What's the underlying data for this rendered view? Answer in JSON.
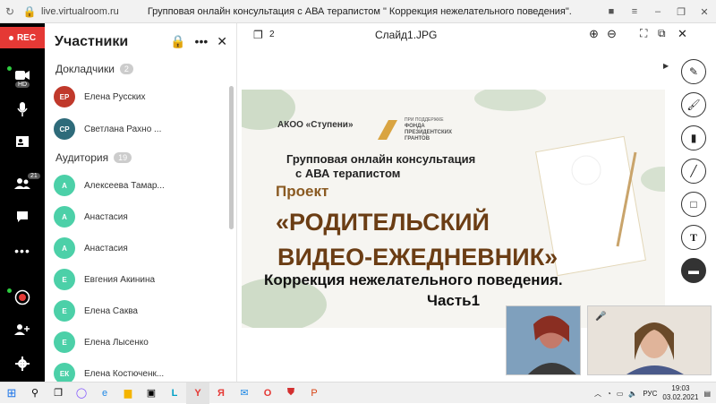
{
  "browser": {
    "url": "live.virtualroom.ru",
    "title": "Групповая онлайн консультация с АВА терапистом \" Коррекция нежелательного поведения\"."
  },
  "rail": {
    "rec_label": "REC",
    "hd_badge": "HD",
    "participants_count": "21"
  },
  "participants": {
    "title": "Участники",
    "speakers_label": "Докладчики",
    "speakers_count": "2",
    "audience_label": "Аудитория",
    "audience_count": "19",
    "speakers": [
      {
        "initials": "ЕР",
        "name": "Елена Русских",
        "color": "#c0392b"
      },
      {
        "initials": "СР",
        "name": "Светлана Рахно ...",
        "color": "#2e6b7a"
      }
    ],
    "audience": [
      {
        "initials": "А",
        "name": "Алексеева Тамар..."
      },
      {
        "initials": "А",
        "name": "Анастасия"
      },
      {
        "initials": "А",
        "name": "Анастасия"
      },
      {
        "initials": "Е",
        "name": "Евгения Акинина"
      },
      {
        "initials": "Е",
        "name": "Елена Саква"
      },
      {
        "initials": "Е",
        "name": "Елена Лысенко"
      },
      {
        "initials": "ЕК",
        "name": "Елена Костюченк..."
      }
    ],
    "audience_color": "#4cd0a8"
  },
  "main": {
    "pages": "2",
    "filename": "Слайд1.JPG"
  },
  "slide": {
    "org": "АКОО «Ступени»",
    "support_small": "ПРИ ПОДДЕРЖКЕ",
    "fund": "ФОНДА ПРЕЗИДЕНТСКИХ ГРАНТОВ",
    "line1": "Групповая онлайн консультация",
    "line2": "с АВА терапистом",
    "project": "Проект",
    "title1": "«РОДИТЕЛЬСКИЙ",
    "title2": "ВИДЕО-ЕЖЕДНЕВНИК»",
    "subtitle": "Коррекция нежелательного поведения.",
    "part": "Часть1"
  },
  "taskbar": {
    "lang": "РУС",
    "time": "19:03",
    "date": "03.02.2021"
  }
}
